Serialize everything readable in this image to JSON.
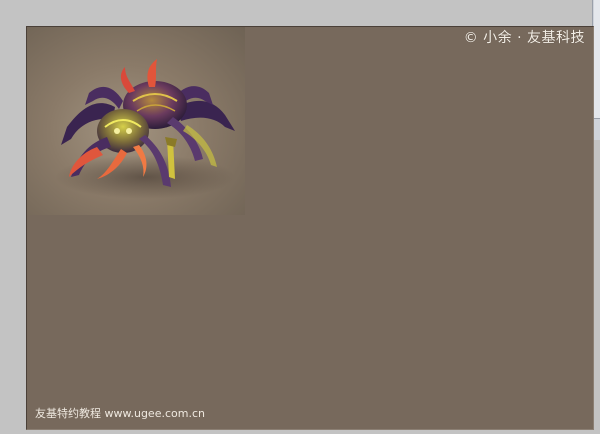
{
  "watermark": {
    "copyright": "© 小余 · 友基科技",
    "footer": "友基特约教程 www.ugee.com.cn"
  },
  "colors": {
    "workspace": "#c3c3c3",
    "canvas": "#77695c",
    "artwork_bg": "#8a7a68"
  },
  "artwork": {
    "subject": "spider-creature-illustration"
  }
}
